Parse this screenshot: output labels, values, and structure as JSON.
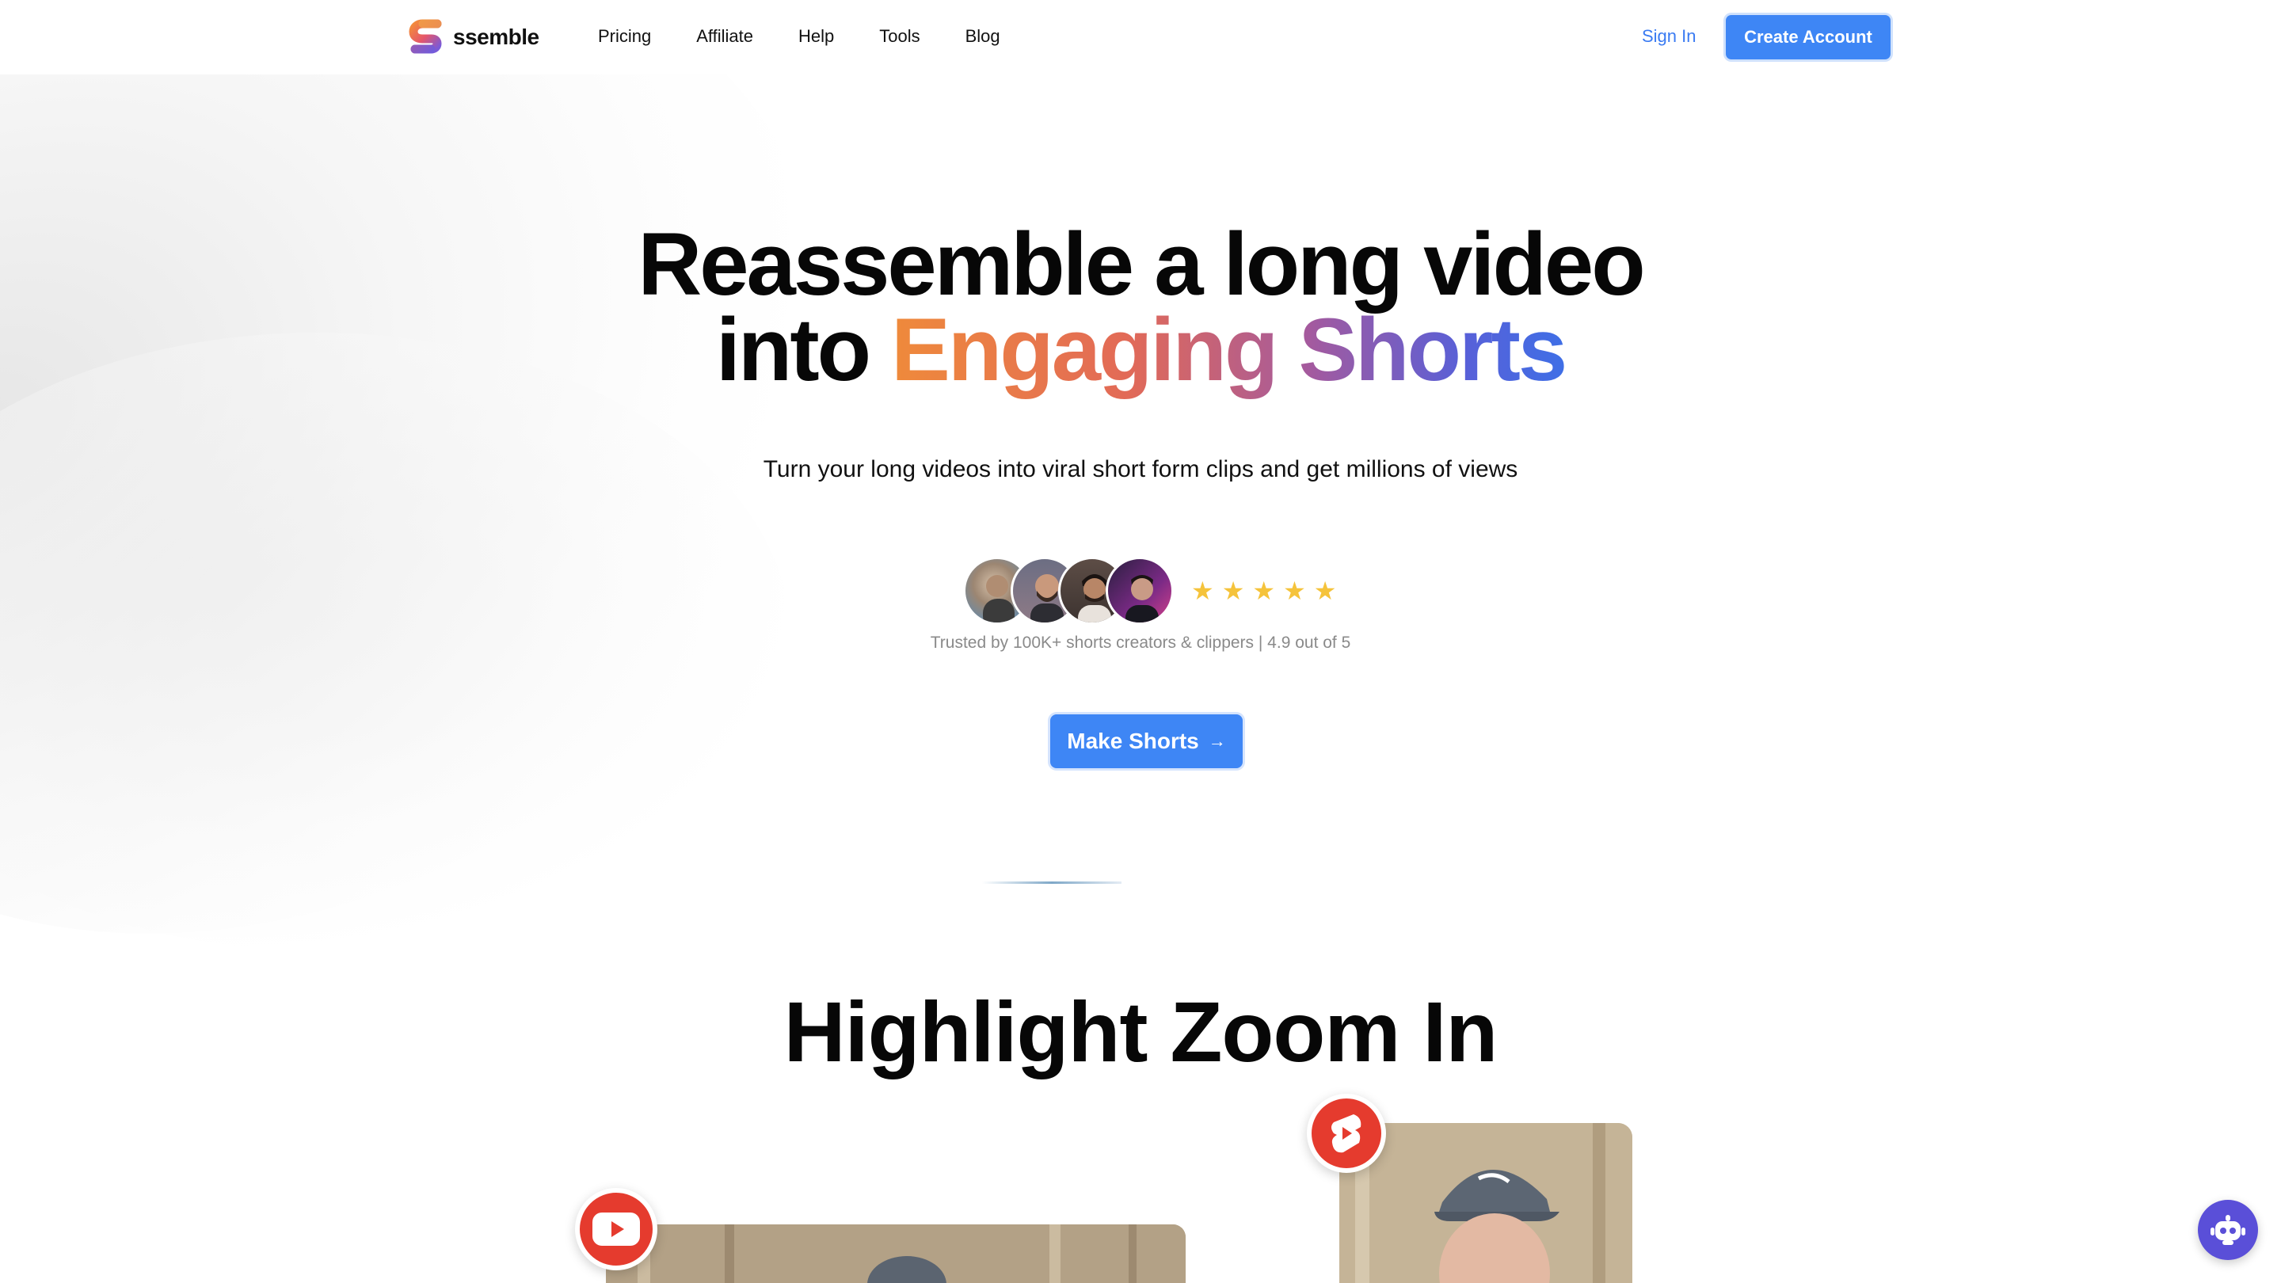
{
  "brand": {
    "name": "ssemble"
  },
  "nav": {
    "links": [
      "Pricing",
      "Affiliate",
      "Help",
      "Tools",
      "Blog"
    ],
    "sign_in": "Sign In",
    "create_account": "Create Account"
  },
  "hero": {
    "title_line1": "Reassemble a long video",
    "title_line2_prefix": "into ",
    "title_highlight": "Engaging Shorts",
    "subtitle": "Turn your long videos into viral short form clips and get millions of views",
    "rating_stars": 5,
    "trusted_text": "Trusted by 100K+ shorts creators & clippers | 4.9 out of 5",
    "cta_label": "Make Shorts",
    "cta_arrow": "→"
  },
  "section": {
    "title": "Highlight Zoom In"
  },
  "colors": {
    "accent": "#3e86f5",
    "gradient_start": "#ef8a3b",
    "gradient_end": "#3f6fe6",
    "star": "#f5c33b",
    "youtube_red": "#e53b2e",
    "chatbot": "#5a4fd8"
  },
  "icons": {
    "logo": "ssemble-logo-icon",
    "youtube": "youtube-icon",
    "shorts": "youtube-shorts-icon",
    "chat": "chatbot-icon"
  }
}
